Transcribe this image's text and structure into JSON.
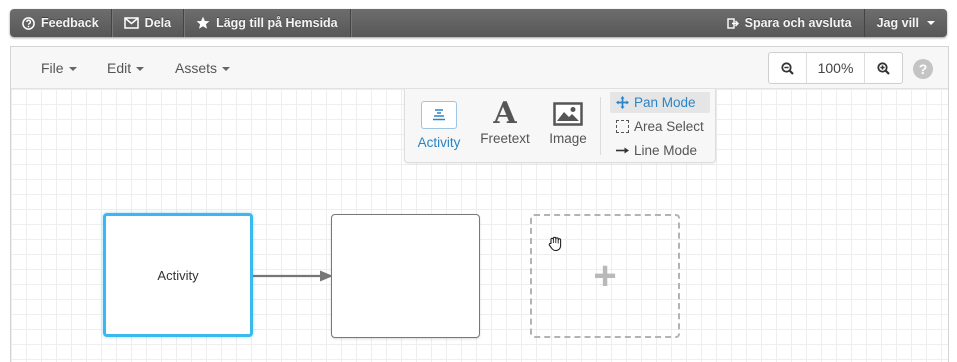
{
  "topbar": {
    "feedback": "Feedback",
    "share": "Dela",
    "add_home": "Lägg till på Hemsida",
    "save_exit": "Spara och avsluta",
    "user_menu": "Jag vill"
  },
  "menus": {
    "file": "File",
    "edit": "Edit",
    "assets": "Assets"
  },
  "zoom": {
    "level": "100%",
    "help": "?"
  },
  "palette": {
    "tools": [
      {
        "label": "Activity",
        "icon": "activity-icon",
        "active": true
      },
      {
        "label": "Freetext",
        "icon": "text-icon"
      },
      {
        "label": "Image",
        "icon": "image-icon"
      }
    ],
    "modes": [
      {
        "label": "Pan Mode",
        "icon": "pan-icon",
        "active": true
      },
      {
        "label": "Area Select",
        "icon": "area-select-icon"
      },
      {
        "label": "Line Mode",
        "icon": "line-arrow-icon"
      }
    ]
  },
  "diagram": {
    "nodes": [
      {
        "label": "Activity",
        "state": "selected"
      },
      {
        "label": "",
        "state": "normal"
      },
      {
        "label": "",
        "state": "placeholder-add"
      }
    ]
  },
  "colors": {
    "accent": "#2a84c6",
    "selection": "#3bb8ef",
    "topbar": "#5f5f5f"
  }
}
